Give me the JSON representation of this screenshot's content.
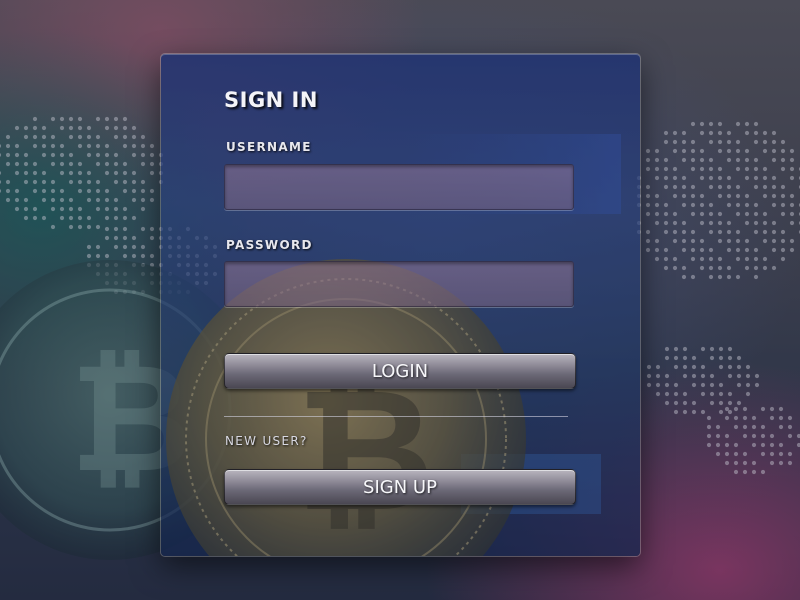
{
  "login_form": {
    "title": "SIGN IN",
    "username_label": "USERNAME",
    "username_value": "",
    "password_label": "PASSWORD",
    "password_value": "",
    "login_button": "LOGIN",
    "new_user_text": "NEW USER?",
    "signup_button": "SIGN UP"
  },
  "background": {
    "theme": "bitcoin coin with dotted world map",
    "icons": [
      "bitcoin-coin-image",
      "world-map-dots"
    ]
  },
  "colors": {
    "panel_blue": "#2a3f80",
    "field_mauve": "#8a7090",
    "button_gray": "#7a7784",
    "text_white": "#f4f4f8"
  }
}
